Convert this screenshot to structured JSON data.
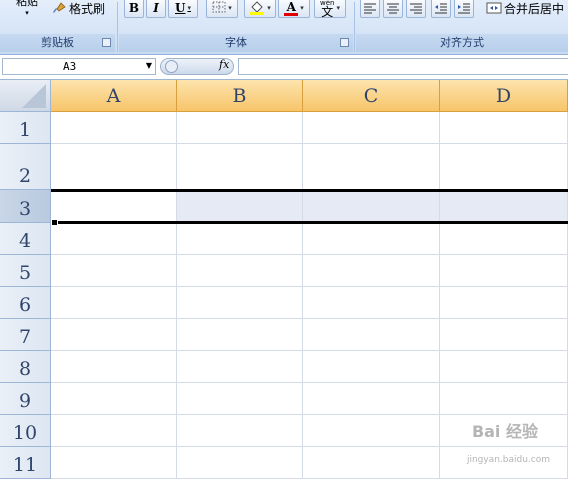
{
  "ribbon": {
    "clipboard": {
      "paste_label": "粘贴",
      "format_painter_label": "格式刷",
      "group_label": "剪贴板"
    },
    "font": {
      "bold": "B",
      "italic": "I",
      "underline": "U",
      "font_color_letter": "A",
      "phonetic_top": "wén",
      "phonetic_char": "文",
      "group_label": "字体"
    },
    "alignment": {
      "merge_center_label": "合并后居中",
      "group_label": "对齐方式"
    }
  },
  "formula_bar": {
    "name_box_value": "A3",
    "fx_label": "fx",
    "formula_value": ""
  },
  "sheet": {
    "columns": [
      "A",
      "B",
      "C",
      "D"
    ],
    "rows": [
      "1",
      "2",
      "3",
      "4",
      "5",
      "6",
      "7",
      "8",
      "9",
      "10",
      "11"
    ],
    "selected_row": "3",
    "active_cell": "A3"
  },
  "watermark": {
    "text": "Bai 经验",
    "subtext": "jingyan.baidu.com"
  },
  "colors": {
    "header_highlight": "#f7c56a",
    "selected_row_fill": "#e6eaf4",
    "ribbon_bg": "#d7e5f7"
  }
}
